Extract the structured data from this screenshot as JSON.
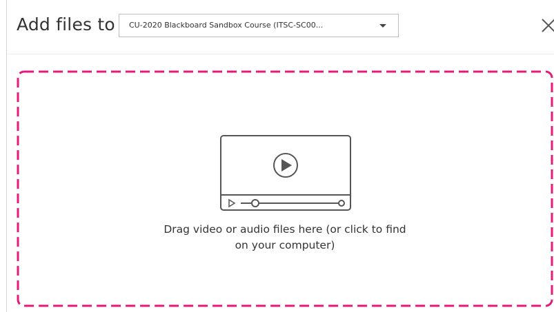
{
  "dialog": {
    "title": "Add files to",
    "folder_select": {
      "selected_value": "CU-2020 Blackboard Sandbox Course (ITSC-SC00..."
    },
    "close_icon": "close-icon"
  },
  "drop_zone": {
    "icon": "video-player-icon",
    "instruction_line1": "Drag video or audio files here (or click to find",
    "instruction_line2": "on your computer)",
    "border_color": "#e6197a"
  },
  "colors": {
    "accent_border": "#e6197a",
    "text": "#333333",
    "icon": "#555555"
  }
}
